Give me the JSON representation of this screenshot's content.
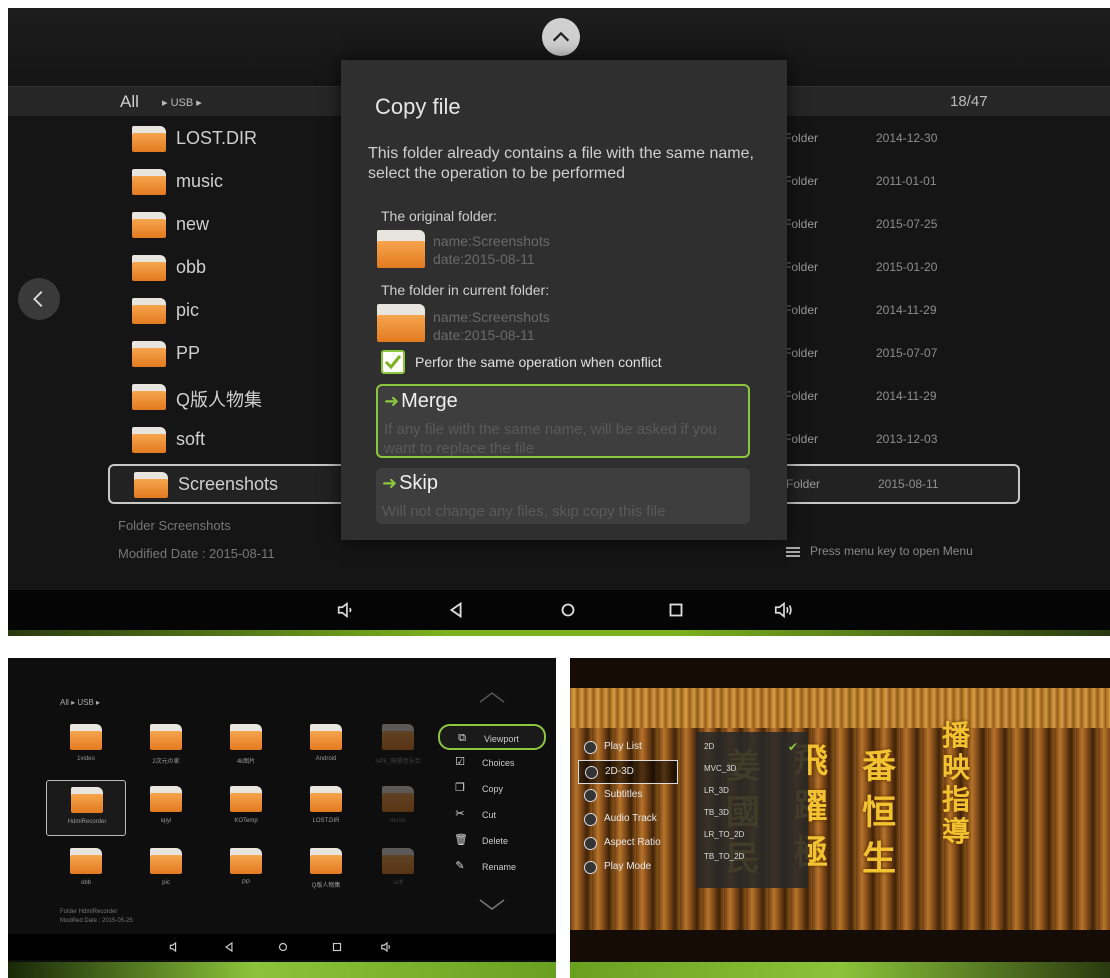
{
  "top_screen": {
    "path": {
      "all": "All",
      "crumb": "▸ USB ▸",
      "count": "18/47"
    },
    "files": [
      {
        "name": "LOST.DIR",
        "type": "Folder",
        "date": "2014-12-30"
      },
      {
        "name": "music",
        "type": "Folder",
        "date": "2011-01-01"
      },
      {
        "name": "new",
        "type": "Folder",
        "date": "2015-07-25"
      },
      {
        "name": "obb",
        "type": "Folder",
        "date": "2015-01-20"
      },
      {
        "name": "pic",
        "type": "Folder",
        "date": "2014-11-29"
      },
      {
        "name": "PP",
        "type": "Folder",
        "date": "2015-07-07"
      },
      {
        "name": "Q版人物集",
        "type": "Folder",
        "date": "2014-11-29"
      },
      {
        "name": "soft",
        "type": "Folder",
        "date": "2013-12-03"
      },
      {
        "name": "Screenshots",
        "type": "Folder",
        "date": "2015-08-11"
      }
    ],
    "info": {
      "line1": "Folder   Screenshots",
      "line2": "Modified Date : 2015-08-11"
    },
    "menu_hint": "Press menu key to open Menu",
    "dialog": {
      "title": "Copy file",
      "message": "This folder already contains a file with the same name, select the operation to be performed",
      "original_label": "The original folder:",
      "original_name": "name:Screenshots",
      "original_date": "date:2015-08-11",
      "current_label": "The folder in current folder:",
      "current_name": "name:Screenshots",
      "current_date": "date:2015-08-11",
      "checkbox_label": "Perfor the same operation when conflict",
      "merge_label": "Merge",
      "merge_desc": "If any file with the same name, will be asked if you want to replace the file",
      "skip_label": "Skip",
      "skip_desc": "Will not change any files, skip copy this file"
    }
  },
  "bottom_left": {
    "path": "All  ▸ USB ▸",
    "grid": [
      {
        "label": "1video"
      },
      {
        "label": "2次元の家"
      },
      {
        "label": "4k图片"
      },
      {
        "label": "Android"
      },
      {
        "label": "APE_無損音乐合"
      },
      {
        "label": "HdmiRecorder"
      },
      {
        "label": "iqiyi"
      },
      {
        "label": "KOTemp"
      },
      {
        "label": "LOST.DIR"
      },
      {
        "label": "music"
      },
      {
        "label": "obb"
      },
      {
        "label": "pic"
      },
      {
        "label": "PP"
      },
      {
        "label": "Q版人物集"
      },
      {
        "label": "soft"
      }
    ],
    "info_line1": "Folder   HdmiRecorder",
    "info_line2": "Modified Date : 2015-05-25",
    "menu": [
      {
        "label": "Viewport",
        "icon": "viewport-icon"
      },
      {
        "label": "Choices",
        "icon": "checkbox-icon"
      },
      {
        "label": "Copy",
        "icon": "copy-icon"
      },
      {
        "label": "Cut",
        "icon": "scissors-icon"
      },
      {
        "label": "Delete",
        "icon": "trash-icon"
      },
      {
        "label": "Rename",
        "icon": "pen-icon"
      }
    ]
  },
  "bottom_right": {
    "play_menu": [
      {
        "label": "Play List"
      },
      {
        "label": "2D-3D"
      },
      {
        "label": "Subtitles"
      },
      {
        "label": "Audio Track"
      },
      {
        "label": "Aspect Ratio"
      },
      {
        "label": "Play Mode"
      }
    ],
    "submenu": [
      "2D",
      "MVC_3D",
      "LR_3D",
      "TB_3D",
      "LR_TO_2D",
      "TB_TO_2D"
    ]
  },
  "colors": {
    "accent_green": "#8cc63f",
    "folder_orange": "#f08a2c",
    "background": "#151515"
  }
}
